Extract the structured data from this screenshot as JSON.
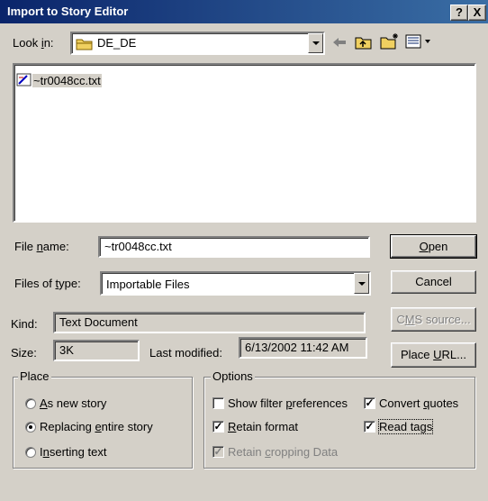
{
  "window": {
    "title": "Import to Story Editor",
    "help": "?",
    "close": "X"
  },
  "look_in": {
    "label_pre": "Look ",
    "label_u": "i",
    "label_post": "n:",
    "folder": "DE_DE"
  },
  "file_list": [
    {
      "name": "~tr0048cc.txt"
    }
  ],
  "file_name": {
    "label_pre": "File ",
    "label_u": "n",
    "label_post": "ame:",
    "value": "~tr0048cc.txt"
  },
  "file_type": {
    "label_pre": "Files of ",
    "label_u": "t",
    "label_post": "ype:",
    "value": "Importable Files"
  },
  "kind": {
    "label": "Kind:",
    "value": "Text Document"
  },
  "size": {
    "label": "Size:",
    "value": "3K"
  },
  "modified": {
    "label": "Last modified:",
    "value": "6/13/2002 11:42 AM"
  },
  "buttons": {
    "open": {
      "u": "O",
      "rest": "pen"
    },
    "cancel": "Cancel",
    "cms": {
      "pre": "C",
      "u": "M",
      "post": "S source..."
    },
    "place_url": {
      "pre": "Place ",
      "u": "U",
      "post": "RL..."
    }
  },
  "place": {
    "label": "Place",
    "as_new": {
      "u": "A",
      "rest": "s new story"
    },
    "replacing": {
      "pre": "Replacing ",
      "u": "e",
      "post": "ntire story"
    },
    "inserting": {
      "pre": "I",
      "u": "n",
      "post": "serting text"
    },
    "selected": "replacing"
  },
  "options": {
    "label": "Options",
    "show_filter": {
      "pre": "Show filter ",
      "u": "p",
      "post": "references",
      "checked": false
    },
    "retain_format": {
      "pre": "",
      "u": "R",
      "post": "etain format",
      "checked": true
    },
    "retain_cropping": {
      "pre": "Retain ",
      "u": "c",
      "post": "ropping Data",
      "checked": true,
      "disabled": true
    },
    "convert_quotes": {
      "pre": "Convert ",
      "u": "q",
      "post": "uotes",
      "checked": true
    },
    "read_tags": {
      "pre": "Read tags",
      "checked": true
    }
  }
}
